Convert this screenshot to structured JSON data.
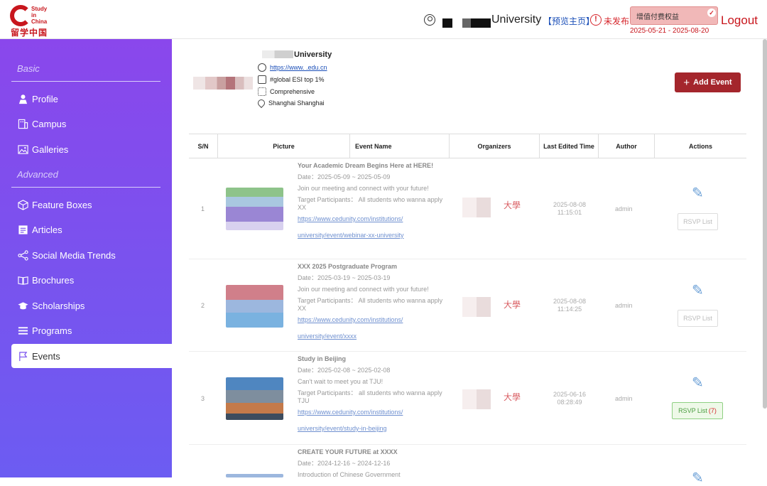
{
  "brand": {
    "line1": "Study",
    "line2": "in",
    "line3": "China",
    "cn": "留学中国"
  },
  "header": {
    "university": "University",
    "preview": "【预览主页】",
    "unpublished": "未发布",
    "vas_label": "增值付费权益",
    "vas_date": "2025-05-21 - 2025-08-20",
    "logout": "Logout",
    "warn_glyph": "!",
    "check_glyph": "✓"
  },
  "sidebar": {
    "basic_label": "Basic",
    "advanced_label": "Advanced",
    "basic_items": [
      {
        "label": "Profile",
        "icon": "person-icon"
      },
      {
        "label": "Campus",
        "icon": "building-icon"
      },
      {
        "label": "Galleries",
        "icon": "image-icon"
      }
    ],
    "advanced_items": [
      {
        "label": "Feature Boxes",
        "icon": "cube-icon"
      },
      {
        "label": "Articles",
        "icon": "article-icon"
      },
      {
        "label": "Social Media Trends",
        "icon": "share-icon"
      },
      {
        "label": "Brochures",
        "icon": "book-icon"
      },
      {
        "label": "Scholarships",
        "icon": "graduation-cap-icon"
      },
      {
        "label": "Programs",
        "icon": "list-icon"
      },
      {
        "label": "Events",
        "icon": "flag-icon",
        "active": true
      }
    ]
  },
  "profile": {
    "name": "University",
    "website": "https://www.      .edu.cn",
    "ranking": "#global ESI top 1%",
    "type": "Comprehensive",
    "location": "Shanghai Shanghai"
  },
  "actions": {
    "add_event": "Add Event",
    "add_glyph": "+"
  },
  "table": {
    "columns": [
      "S/N",
      "Picture",
      "Event Name",
      "Organizers",
      "Last Edited Time",
      "Author",
      "Actions"
    ],
    "rows": [
      {
        "sn": "1",
        "title": "Your Academic Dream Begins Here at HERE!",
        "date": "Date：2025-05-09 ~ 2025-05-09",
        "desc": "Join our meeting and connect with your future!",
        "target": "Target Participants：  All students who wanna apply XX",
        "link1": "https://www.cedunity.com/institutions/",
        "link2": "university/event/webinar-xx-university",
        "org": "大學",
        "time1": "2025-08-08",
        "time2": "11:15:01",
        "author": "admin",
        "rsvp": "RSVP List",
        "rsvp_count": ""
      },
      {
        "sn": "2",
        "title": "XXX 2025 Postgraduate Program",
        "date": "Date：2025-03-19 ~ 2025-03-19",
        "desc": "Join our meeting and connect with your future!",
        "target": "Target Participants：  All students who wanna apply XX",
        "link1": "https://www.cedunity.com/institutions/",
        "link2": "university/event/xxxx",
        "org": "大學",
        "time1": "2025-08-08",
        "time2": "11:14:25",
        "author": "admin",
        "rsvp": "RSVP List",
        "rsvp_count": ""
      },
      {
        "sn": "3",
        "title": "Study in Beijing",
        "date": "Date：2025-02-08 ~ 2025-02-08",
        "desc": "Can't wait to meet you at TJU!",
        "target": "Target Participants：  all students who wanna apply TJU",
        "link1": "https://www.cedunity.com/institutions/",
        "link2": "university/event/study-in-beijing",
        "org": "大學",
        "time1": "2025-06-16",
        "time2": "08:28:49",
        "author": "admin",
        "rsvp": "RSVP List",
        "rsvp_count": "(7)"
      },
      {
        "sn": "",
        "title": "CREATE YOUR FUTURE at XXXX",
        "date": "Date：2024-12-16 ~ 2024-12-16",
        "desc": "Introduction of Chinese Government"
      }
    ]
  },
  "colors": {
    "brand_red": "#c8161d",
    "sidebar_top": "#8a47ec",
    "sidebar_bottom": "#6c5cf2",
    "button": "#a4262c"
  }
}
